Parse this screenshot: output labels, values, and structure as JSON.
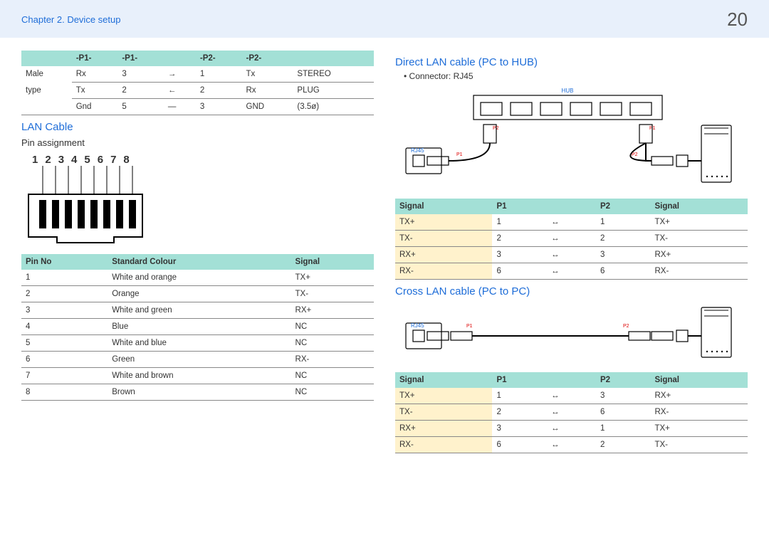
{
  "header": {
    "chapter": "Chapter 2. Device setup",
    "page": "20"
  },
  "stereoTable": {
    "headers": [
      "-P1-",
      "-P1-",
      "",
      "-P2-",
      "-P2-",
      ""
    ],
    "leftLabel": {
      "l1": "Male",
      "l2": "type"
    },
    "rows": [
      [
        "Rx",
        "3",
        "→",
        "1",
        "Tx",
        "STEREO"
      ],
      [
        "Tx",
        "2",
        "←",
        "2",
        "Rx",
        "PLUG"
      ],
      [
        "Gnd",
        "5",
        "—",
        "3",
        "GND",
        "(3.5ø)"
      ]
    ]
  },
  "lan": {
    "title": "LAN Cable",
    "subtitle": "Pin assignment",
    "pins": [
      "1",
      "2",
      "3",
      "4",
      "5",
      "6",
      "7",
      "8"
    ],
    "tableHeaders": [
      "Pin No",
      "Standard Colour",
      "Signal"
    ],
    "rows": [
      [
        "1",
        "White and orange",
        "TX+"
      ],
      [
        "2",
        "Orange",
        "TX-"
      ],
      [
        "3",
        "White and green",
        "RX+"
      ],
      [
        "4",
        "Blue",
        "NC"
      ],
      [
        "5",
        "White and blue",
        "NC"
      ],
      [
        "6",
        "Green",
        "RX-"
      ],
      [
        "7",
        "White and brown",
        "NC"
      ],
      [
        "8",
        "Brown",
        "NC"
      ]
    ]
  },
  "direct": {
    "title": "Direct LAN cable (PC to HUB)",
    "connector": "Connector: RJ45",
    "labels": {
      "hub": "HUB",
      "rj45": "RJ45",
      "p1": "P1",
      "p2": "P2"
    },
    "tableHeaders": [
      "Signal",
      "P1",
      "",
      "P2",
      "Signal"
    ],
    "rows": [
      [
        "TX+",
        "1",
        "↔",
        "1",
        "TX+"
      ],
      [
        "TX-",
        "2",
        "↔",
        "2",
        "TX-"
      ],
      [
        "RX+",
        "3",
        "↔",
        "3",
        "RX+"
      ],
      [
        "RX-",
        "6",
        "↔",
        "6",
        "RX-"
      ]
    ]
  },
  "cross": {
    "title": "Cross LAN cable (PC to PC)",
    "labels": {
      "rj45": "RJ45",
      "p1": "P1",
      "p2": "P2"
    },
    "tableHeaders": [
      "Signal",
      "P1",
      "",
      "P2",
      "Signal"
    ],
    "rows": [
      [
        "TX+",
        "1",
        "↔",
        "3",
        "RX+"
      ],
      [
        "TX-",
        "2",
        "↔",
        "6",
        "RX-"
      ],
      [
        "RX+",
        "3",
        "↔",
        "1",
        "TX+"
      ],
      [
        "RX-",
        "6",
        "↔",
        "2",
        "TX-"
      ]
    ]
  }
}
